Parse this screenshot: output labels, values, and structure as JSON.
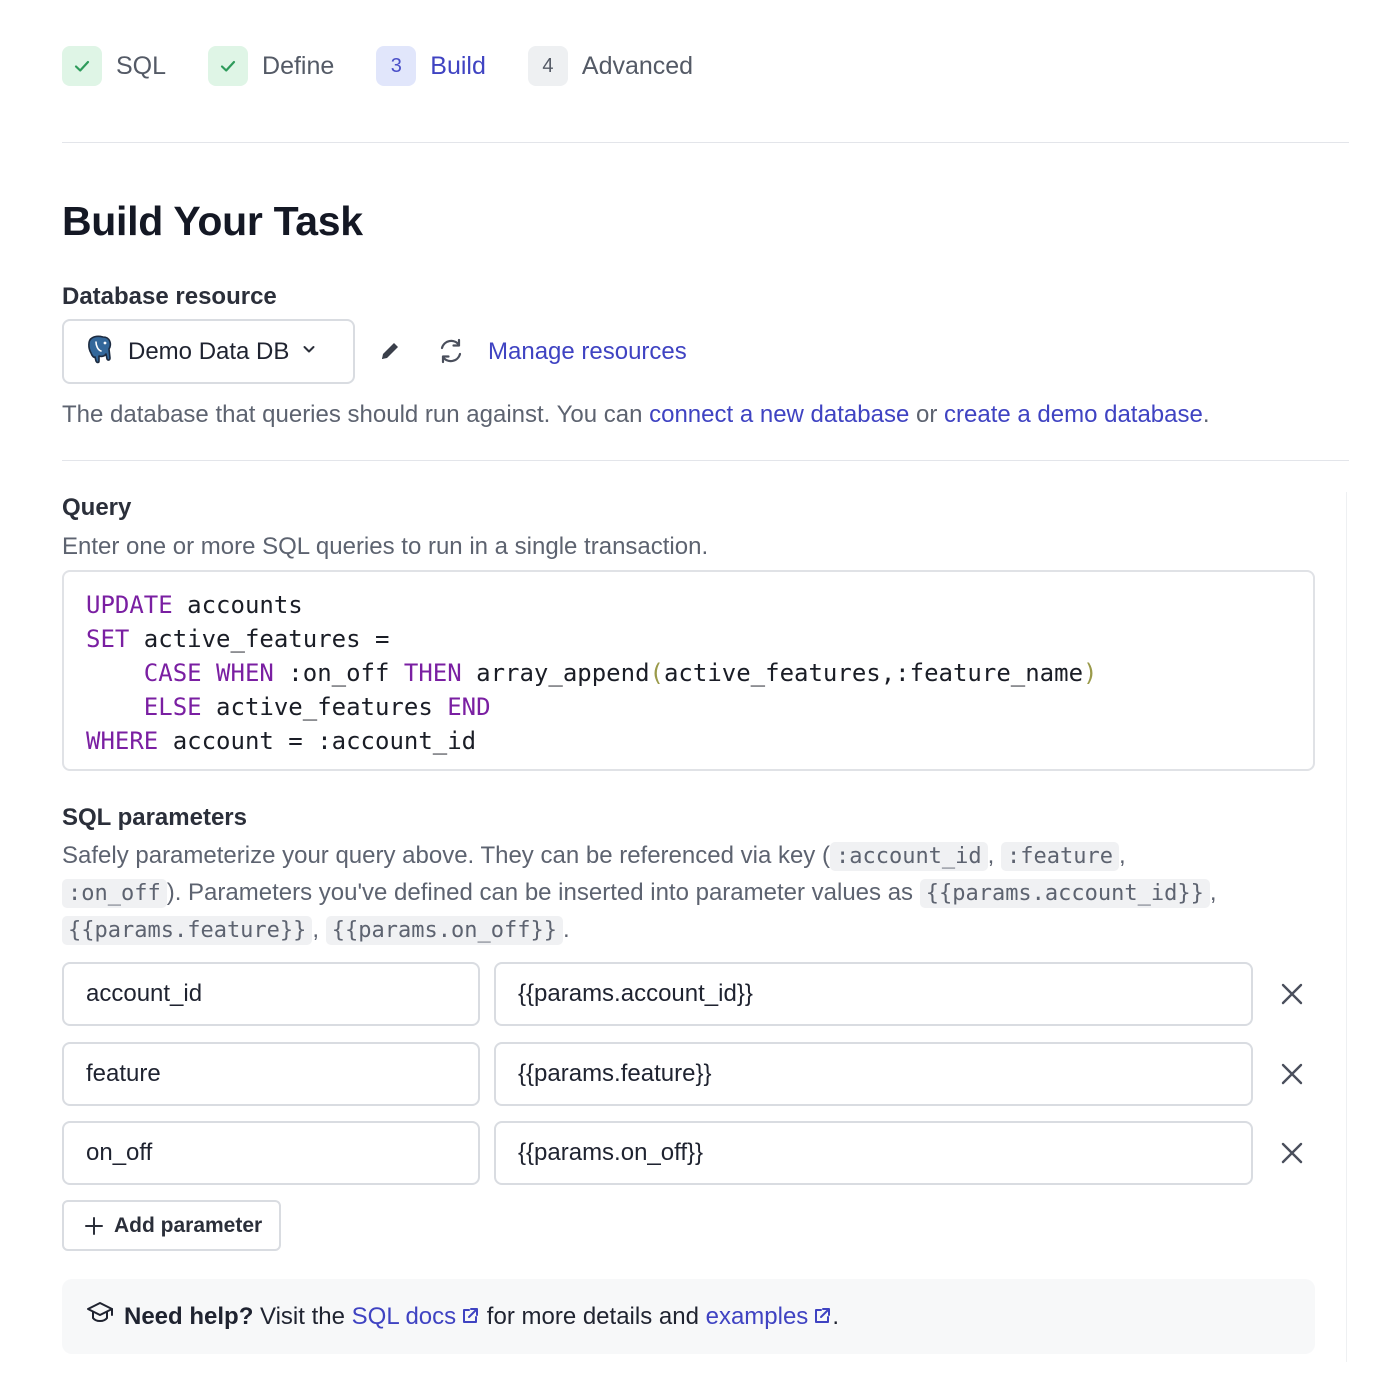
{
  "stepper": {
    "steps": [
      {
        "label": "SQL",
        "state": "done",
        "badge": ""
      },
      {
        "label": "Define",
        "state": "done",
        "badge": ""
      },
      {
        "label": "Build",
        "state": "current",
        "badge": "3"
      },
      {
        "label": "Advanced",
        "state": "todo",
        "badge": "4"
      }
    ]
  },
  "page": {
    "title": "Build Your Task"
  },
  "resource": {
    "label": "Database resource",
    "selected": "Demo Data DB",
    "manage_link": "Manage resources",
    "help_prefix": "The database that queries should run against. You can ",
    "help_link1": "connect a new database",
    "help_mid": " or ",
    "help_link2": "create a demo database",
    "help_suffix": "."
  },
  "query": {
    "label": "Query",
    "help": "Enter one or more SQL queries to run in a single transaction.",
    "lines": [
      [
        "UPDATE",
        " accounts"
      ],
      [
        "SET",
        " active_features ="
      ],
      [
        "    ",
        "CASE",
        " ",
        "WHEN",
        " :on_off ",
        "THEN",
        " array_append",
        "(",
        "active_features,:feature_name",
        ")"
      ],
      [
        "    ",
        "ELSE",
        " active_features ",
        "END"
      ],
      [
        "WHERE",
        " account = :account_id"
      ]
    ]
  },
  "sql_params": {
    "label": "SQL parameters",
    "help_1": "Safely parameterize your query above. They can be referenced via key (",
    "key_1": ":account_id",
    "sep_1": ", ",
    "key_2": ":feature",
    "sep_2": ",",
    "key_3": ":on_off",
    "help_2": "). Parameters you've defined can be inserted into parameter values as ",
    "ref_1": "{{params.account_id}}",
    "sep_3": ",",
    "ref_2": "{{params.feature}}",
    "sep_4": ", ",
    "ref_3": "{{params.on_off}}",
    "help_end": ".",
    "rows": [
      {
        "key": "account_id",
        "value": "{{params.account_id}}"
      },
      {
        "key": "feature",
        "value": "{{params.feature}}"
      },
      {
        "key": "on_off",
        "value": "{{params.on_off}}"
      }
    ],
    "add_label": "Add parameter"
  },
  "help_box": {
    "bold": "Need help?",
    "text1": " Visit the ",
    "docs_link": "SQL docs",
    "text2": " for more details and ",
    "examples_link": "examples",
    "text3": "."
  },
  "colors": {
    "accent": "#3f43c2",
    "keyword": "#7a1fa2",
    "success_bg": "#dff5e6",
    "success_check": "#2e9b5b"
  }
}
